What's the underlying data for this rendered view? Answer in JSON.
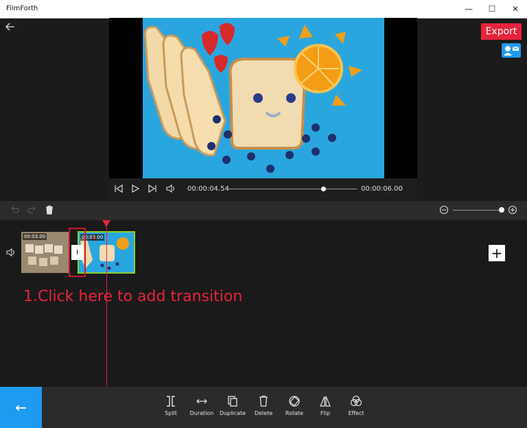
{
  "window": {
    "title": "FilmForth",
    "minimize_glyph": "—",
    "maximize_glyph": "☐",
    "close_glyph": "✕"
  },
  "header": {
    "back_icon": "arrow-left-icon",
    "export_label": "Export",
    "contact_icon": "contact-card-icon"
  },
  "player": {
    "current_time": "00:00:04.54",
    "total_time": "00:00:06.00",
    "progress": 0.74
  },
  "edit_toolbar": {
    "undo_icon": "undo-icon",
    "redo_icon": "redo-icon",
    "delete_icon": "trash-icon",
    "zoom_level": 0.96
  },
  "timeline": {
    "clips": [
      {
        "duration": "00:03.00",
        "thumb": "wooden-letter-tiles"
      },
      {
        "duration": "00:03.00",
        "thumb": "bread-face"
      }
    ],
    "transition_glyph": "I",
    "add_glyph": "+",
    "annotation": "1.Click here to add transition"
  },
  "bottom_toolbar": {
    "back_glyph": "←",
    "tools": [
      {
        "label": "Split",
        "icon": "split-icon"
      },
      {
        "label": "Duration",
        "icon": "duration-icon"
      },
      {
        "label": "Duplicate",
        "icon": "duplicate-icon"
      },
      {
        "label": "Delete",
        "icon": "delete-icon"
      },
      {
        "label": "Rotate",
        "icon": "rotate-icon"
      },
      {
        "label": "Flip",
        "icon": "flip-icon"
      },
      {
        "label": "Effect",
        "icon": "effect-icon"
      }
    ]
  },
  "colors": {
    "accent_red": "#e8233a",
    "accent_blue": "#1e9af0",
    "clip_selected_border": "#8ccf2b"
  }
}
